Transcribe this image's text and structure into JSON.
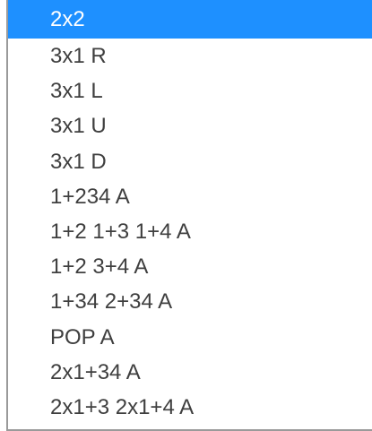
{
  "dropdown": {
    "selected_index": 0,
    "options": [
      "2x2",
      "3x1 R",
      "3x1 L",
      "3x1 U",
      "3x1 D",
      "1+234 A",
      "1+2 1+3 1+4 A",
      "1+2 3+4 A",
      "1+34 2+34 A",
      "POP A",
      "2x1+34 A",
      "2x1+3 2x1+4 A"
    ],
    "colors": {
      "selected_background": "#1e90ff",
      "selected_text": "#ffffff",
      "text": "#3f3f3f",
      "border": "#9a9a9a"
    }
  }
}
